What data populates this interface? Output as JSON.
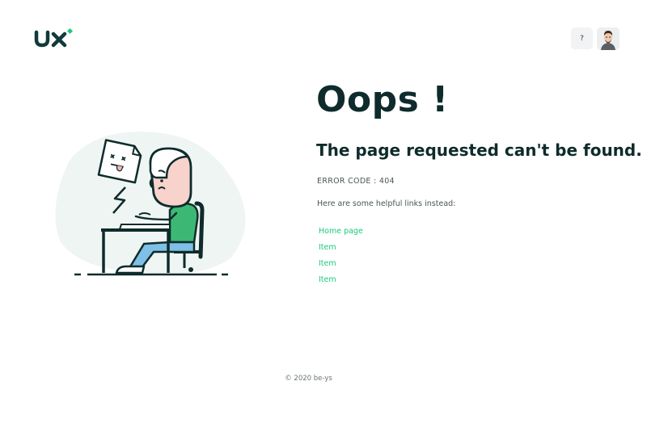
{
  "header": {
    "logo_icon": "ux-logo",
    "help_label": "?",
    "help_icon": "question-icon",
    "avatar_icon": "user-avatar"
  },
  "illustration": {
    "icon": "frustrated-person-at-computer-illustration"
  },
  "main": {
    "title": "Oops !",
    "subtitle": "The page requested can't be found.",
    "error_code": "ERROR CODE : 404",
    "helpful_text": "Here are some helpful links instead:",
    "links": [
      {
        "label": "Home page"
      },
      {
        "label": "Item"
      },
      {
        "label": "Item"
      },
      {
        "label": "Item"
      }
    ]
  },
  "footer": {
    "copyright": "© 2020 be-ys"
  },
  "colors": {
    "accent": "#1ec97a",
    "dark": "#0f2b2b",
    "blob": "#eef5f2"
  }
}
